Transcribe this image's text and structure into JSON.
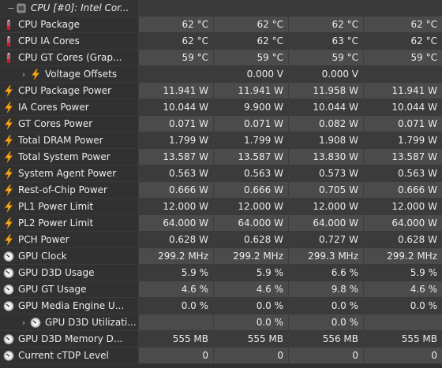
{
  "group_header": {
    "expander": "−",
    "icon": "cpu-chip-icon",
    "title": "CPU [#0]: Intel Cor..."
  },
  "rows": [
    {
      "label": "CPU Package",
      "icon": "thermometer-icon",
      "values": [
        "62 °C",
        "62 °C",
        "62 °C",
        "62 °C"
      ]
    },
    {
      "label": "CPU IA Cores",
      "icon": "thermometer-icon",
      "values": [
        "62 °C",
        "62 °C",
        "63 °C",
        "62 °C"
      ]
    },
    {
      "label": "CPU GT Cores (Grap...",
      "icon": "thermometer-icon",
      "values": [
        "59 °C",
        "59 °C",
        "59 °C",
        "59 °C"
      ]
    },
    {
      "label": "Voltage Offsets",
      "icon": "lightning-icon",
      "expander": "›",
      "values": [
        "",
        "0.000 V",
        "0.000 V",
        ""
      ]
    },
    {
      "label": "CPU Package Power",
      "icon": "lightning-icon",
      "values": [
        "11.941 W",
        "11.941 W",
        "11.958 W",
        "11.941 W"
      ]
    },
    {
      "label": "IA Cores Power",
      "icon": "lightning-icon",
      "values": [
        "10.044 W",
        "9.900 W",
        "10.044 W",
        "10.044 W"
      ]
    },
    {
      "label": "GT Cores Power",
      "icon": "lightning-icon",
      "values": [
        "0.071 W",
        "0.071 W",
        "0.082 W",
        "0.071 W"
      ]
    },
    {
      "label": "Total DRAM Power",
      "icon": "lightning-icon",
      "values": [
        "1.799 W",
        "1.799 W",
        "1.908 W",
        "1.799 W"
      ]
    },
    {
      "label": "Total System Power",
      "icon": "lightning-icon",
      "values": [
        "13.587 W",
        "13.587 W",
        "13.830 W",
        "13.587 W"
      ]
    },
    {
      "label": "System Agent Power",
      "icon": "lightning-icon",
      "values": [
        "0.563 W",
        "0.563 W",
        "0.573 W",
        "0.563 W"
      ]
    },
    {
      "label": "Rest-of-Chip Power",
      "icon": "lightning-icon",
      "values": [
        "0.666 W",
        "0.666 W",
        "0.705 W",
        "0.666 W"
      ]
    },
    {
      "label": "PL1 Power Limit",
      "icon": "lightning-icon",
      "values": [
        "12.000 W",
        "12.000 W",
        "12.000 W",
        "12.000 W"
      ]
    },
    {
      "label": "PL2 Power Limit",
      "icon": "lightning-icon",
      "values": [
        "64.000 W",
        "64.000 W",
        "64.000 W",
        "64.000 W"
      ]
    },
    {
      "label": "PCH Power",
      "icon": "lightning-icon",
      "values": [
        "0.628 W",
        "0.628 W",
        "0.727 W",
        "0.628 W"
      ]
    },
    {
      "label": "GPU Clock",
      "icon": "gauge-icon",
      "values": [
        "299.2 MHz",
        "299.2 MHz",
        "299.3 MHz",
        "299.2 MHz"
      ]
    },
    {
      "label": "GPU D3D Usage",
      "icon": "gauge-icon",
      "values": [
        "5.9 %",
        "5.9 %",
        "6.6 %",
        "5.9 %"
      ]
    },
    {
      "label": "GPU GT Usage",
      "icon": "gauge-icon",
      "values": [
        "4.6 %",
        "4.6 %",
        "9.8 %",
        "4.6 %"
      ]
    },
    {
      "label": "GPU Media Engine U...",
      "icon": "gauge-icon",
      "values": [
        "0.0 %",
        "0.0 %",
        "0.0 %",
        "0.0 %"
      ]
    },
    {
      "label": "GPU D3D Utilizati...",
      "icon": "gauge-icon",
      "expander": "›",
      "values": [
        "",
        "0.0 %",
        "0.0 %",
        ""
      ]
    },
    {
      "label": "GPU D3D Memory D...",
      "icon": "gauge-icon",
      "values": [
        "555 MB",
        "555 MB",
        "556 MB",
        "555 MB"
      ]
    },
    {
      "label": "Current cTDP Level",
      "icon": "gauge-icon",
      "values": [
        "0",
        "0",
        "0",
        "0"
      ]
    }
  ]
}
